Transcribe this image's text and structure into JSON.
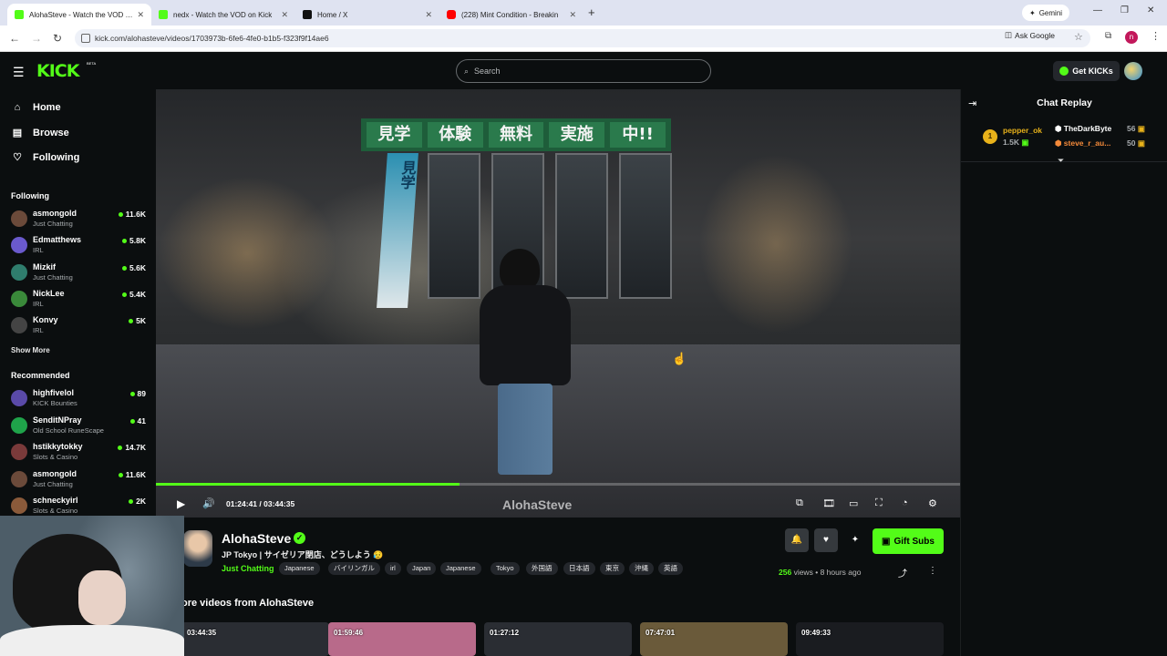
{
  "browser": {
    "tabs": [
      {
        "title": "AlohaSteve - Watch the VOD on Kick",
        "favicon_color": "#53fc18",
        "active": true
      },
      {
        "title": "nedx - Watch the VOD on Kick",
        "favicon_color": "#53fc18",
        "active": false
      },
      {
        "title": "Home / X",
        "favicon_color": "#111111",
        "active": false
      },
      {
        "title": "(228) Mint Condition - Breakin",
        "favicon_color": "#ff0000",
        "active": false
      }
    ],
    "new_tab": "+",
    "gemini_label": "Gemini",
    "url": "kick.com/alohasteve/videos/1703973b-6fe6-4fe0-b1b5-f323f9f14ae6",
    "ask_google": "Ask Google",
    "profile_initial": "n"
  },
  "kick": {
    "logo": "KICK",
    "beta": "BETA",
    "search_placeholder": "Search",
    "get_kicks": "Get KICKs"
  },
  "sidebar": {
    "nav": [
      {
        "label": "Home",
        "icon": "home-icon"
      },
      {
        "label": "Browse",
        "icon": "browse-icon"
      },
      {
        "label": "Following",
        "icon": "heart-icon"
      }
    ],
    "following_heading": "Following",
    "following": [
      {
        "name": "asmongold",
        "category": "Just Chatting",
        "viewers": "11.6K",
        "avatar": "#6b4a3a"
      },
      {
        "name": "Edmatthews",
        "category": "IRL",
        "viewers": "5.8K",
        "avatar": "#6a5acd"
      },
      {
        "name": "Mizkif",
        "category": "Just Chatting",
        "viewers": "5.6K",
        "avatar": "#2f7d6d"
      },
      {
        "name": "NickLee",
        "category": "IRL",
        "viewers": "5.4K",
        "avatar": "#3a8a3a"
      },
      {
        "name": "Konvy",
        "category": "IRL",
        "viewers": "5K",
        "avatar": "#444444"
      }
    ],
    "show_more": "Show More",
    "recommended_heading": "Recommended",
    "recommended": [
      {
        "name": "highfivelol",
        "category": "KICK Bounties",
        "viewers": "89",
        "avatar": "#5a4aa8"
      },
      {
        "name": "SenditNPray",
        "category": "Old School RuneScape",
        "viewers": "41",
        "avatar": "#1fa34a"
      },
      {
        "name": "hstikkytokky",
        "category": "Slots & Casino",
        "viewers": "14.7K",
        "avatar": "#7a3a3a"
      },
      {
        "name": "asmongold",
        "category": "Just Chatting",
        "viewers": "11.6K",
        "avatar": "#6b4a3a"
      },
      {
        "name": "schneckyirl",
        "category": "Slots & Casino",
        "viewers": "2K",
        "avatar": "#8a5a3a"
      }
    ]
  },
  "video": {
    "sign_chars": [
      "見学",
      "体験",
      "無料",
      "実施",
      "中!!"
    ],
    "flag_text": "見学",
    "progress_fraction": 0.377,
    "current_time": "01:24:41",
    "duration": "03:44:35",
    "time_separator": "/",
    "watermark": "AlohaSteve"
  },
  "chat": {
    "title": "Chat Replay",
    "top_gifters": [
      {
        "rank": "1",
        "name": "pepper_ok",
        "amount": "1.5K"
      },
      {
        "name": "TheDarkByte",
        "amount": "56"
      },
      {
        "name": "steve_r_au...",
        "amount": "50"
      }
    ]
  },
  "vod": {
    "streamer": "AlohaSteve",
    "title": "JP Tokyo | サイゼリア閉店、どうしよう 😥",
    "category": "Just Chatting",
    "tags": [
      "Japanese",
      "バイリンガル",
      "irl",
      "Japan",
      "Japanese",
      "Tokyo",
      "外国語",
      "日本語",
      "東京",
      "沖縄",
      "英語"
    ],
    "gift_subs": "Gift Subs",
    "views": "256",
    "views_label": "views",
    "separator": "•",
    "posted": "8 hours ago",
    "more_heading": "ore videos from AlohaSteve",
    "thumbnails": [
      {
        "duration": "03:44:35",
        "color": "#2a2d33"
      },
      {
        "duration": "01:59:46",
        "color": "#b86a8a"
      },
      {
        "duration": "01:27:12",
        "color": "#2a2d33"
      },
      {
        "duration": "07:47:01",
        "color": "#6a5a3a"
      },
      {
        "duration": "09:49:33",
        "color": "#1a1c20"
      }
    ]
  },
  "colors": {
    "accent": "#53fc18",
    "bg": "#0b0e0f"
  }
}
